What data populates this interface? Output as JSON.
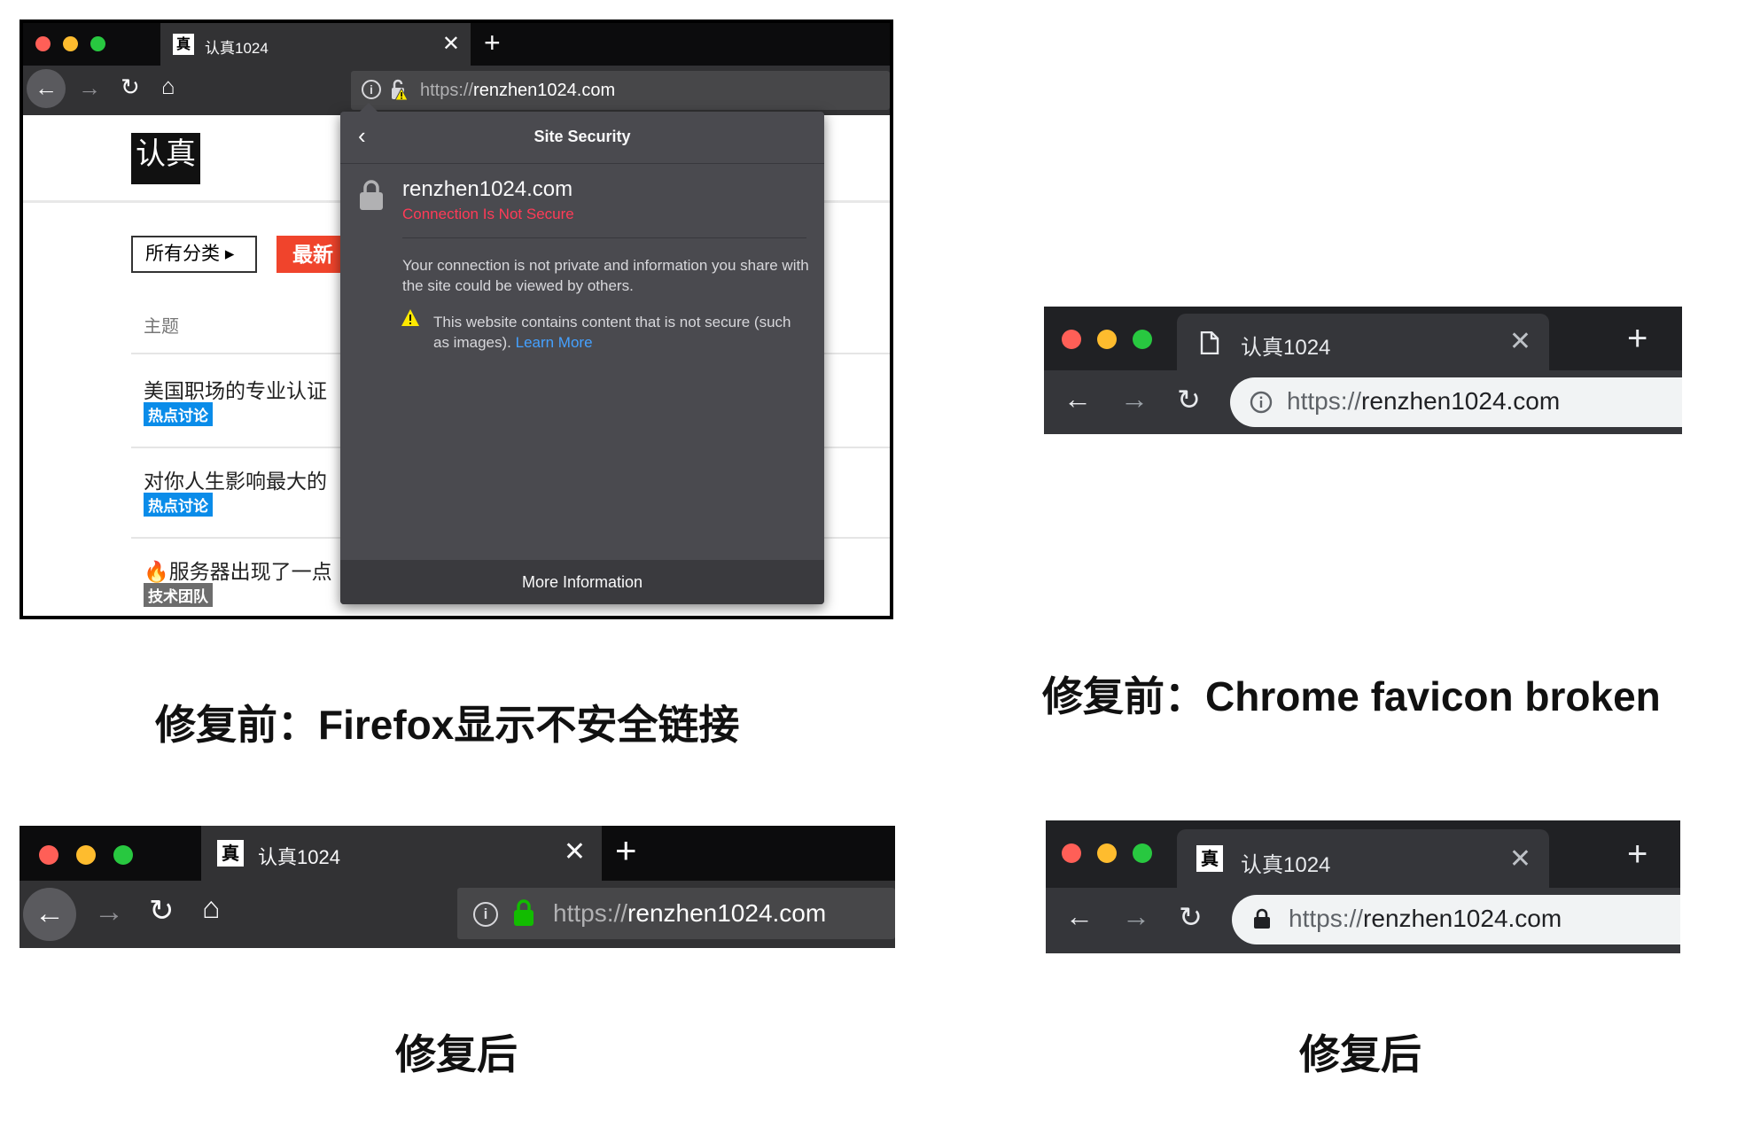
{
  "firefox_before": {
    "tab": {
      "favicon": "认真-favicon",
      "title": "认真1024",
      "close": "✕",
      "new_tab": "+"
    },
    "nav": {
      "back": "←",
      "forward": "→",
      "reload": "↻",
      "home": "⌂"
    },
    "url": {
      "scheme": "https://",
      "host": "renzhen1024.com"
    },
    "page": {
      "logo": "认真",
      "all_categories": "所有分类 ▸",
      "newest": "最新",
      "topic_header": "主题",
      "rows": [
        {
          "title": "美国职场的专业认证",
          "badge": "热点讨论"
        },
        {
          "title": "对你人生影响最大的",
          "badge": "热点讨论"
        },
        {
          "title": "🔥服务器出现了一点",
          "badge": "技术团队"
        }
      ]
    },
    "popup": {
      "back": "‹",
      "title": "Site Security",
      "host": "renzhen1024.com",
      "status": "Connection Is Not Secure",
      "description": "Your connection is not private and information you share with the site could be viewed by others.",
      "warning": "This website contains content that is not secure (such as images).",
      "learn_more": "Learn More",
      "more_info": "More Information"
    },
    "colors": {
      "danger": "#ff3b57",
      "link": "#45a1ff",
      "badge_blue": "#0a8ce9"
    }
  },
  "caption_ff_before": "修复前：Firefox显示不安全链接",
  "chrome_before": {
    "tab": {
      "favicon": "document-icon",
      "title": "认真1024",
      "close": "✕",
      "new_tab": "+"
    },
    "nav": {
      "back": "←",
      "forward": "→",
      "reload": "↻"
    },
    "url": {
      "scheme": "https://",
      "host": "renzhen1024.com"
    }
  },
  "caption_chrome_before": "修复前：Chrome favicon broken",
  "firefox_after": {
    "tab": {
      "favicon": "认真-favicon",
      "title": "认真1024",
      "close": "✕",
      "new_tab": "+"
    },
    "nav": {
      "back": "←",
      "forward": "→",
      "reload": "↻",
      "home": "⌂"
    },
    "url": {
      "scheme": "https://",
      "host": "renzhen1024.com"
    },
    "colors": {
      "secure_lock": "#12bc00"
    }
  },
  "caption_ff_after": "修复后",
  "chrome_after": {
    "tab": {
      "favicon": "认真-favicon",
      "title": "认真1024",
      "close": "✕",
      "new_tab": "+"
    },
    "nav": {
      "back": "←",
      "forward": "→",
      "reload": "↻"
    },
    "url": {
      "scheme": "https://",
      "host": "renzhen1024.com"
    }
  },
  "caption_chrome_after": "修复后"
}
